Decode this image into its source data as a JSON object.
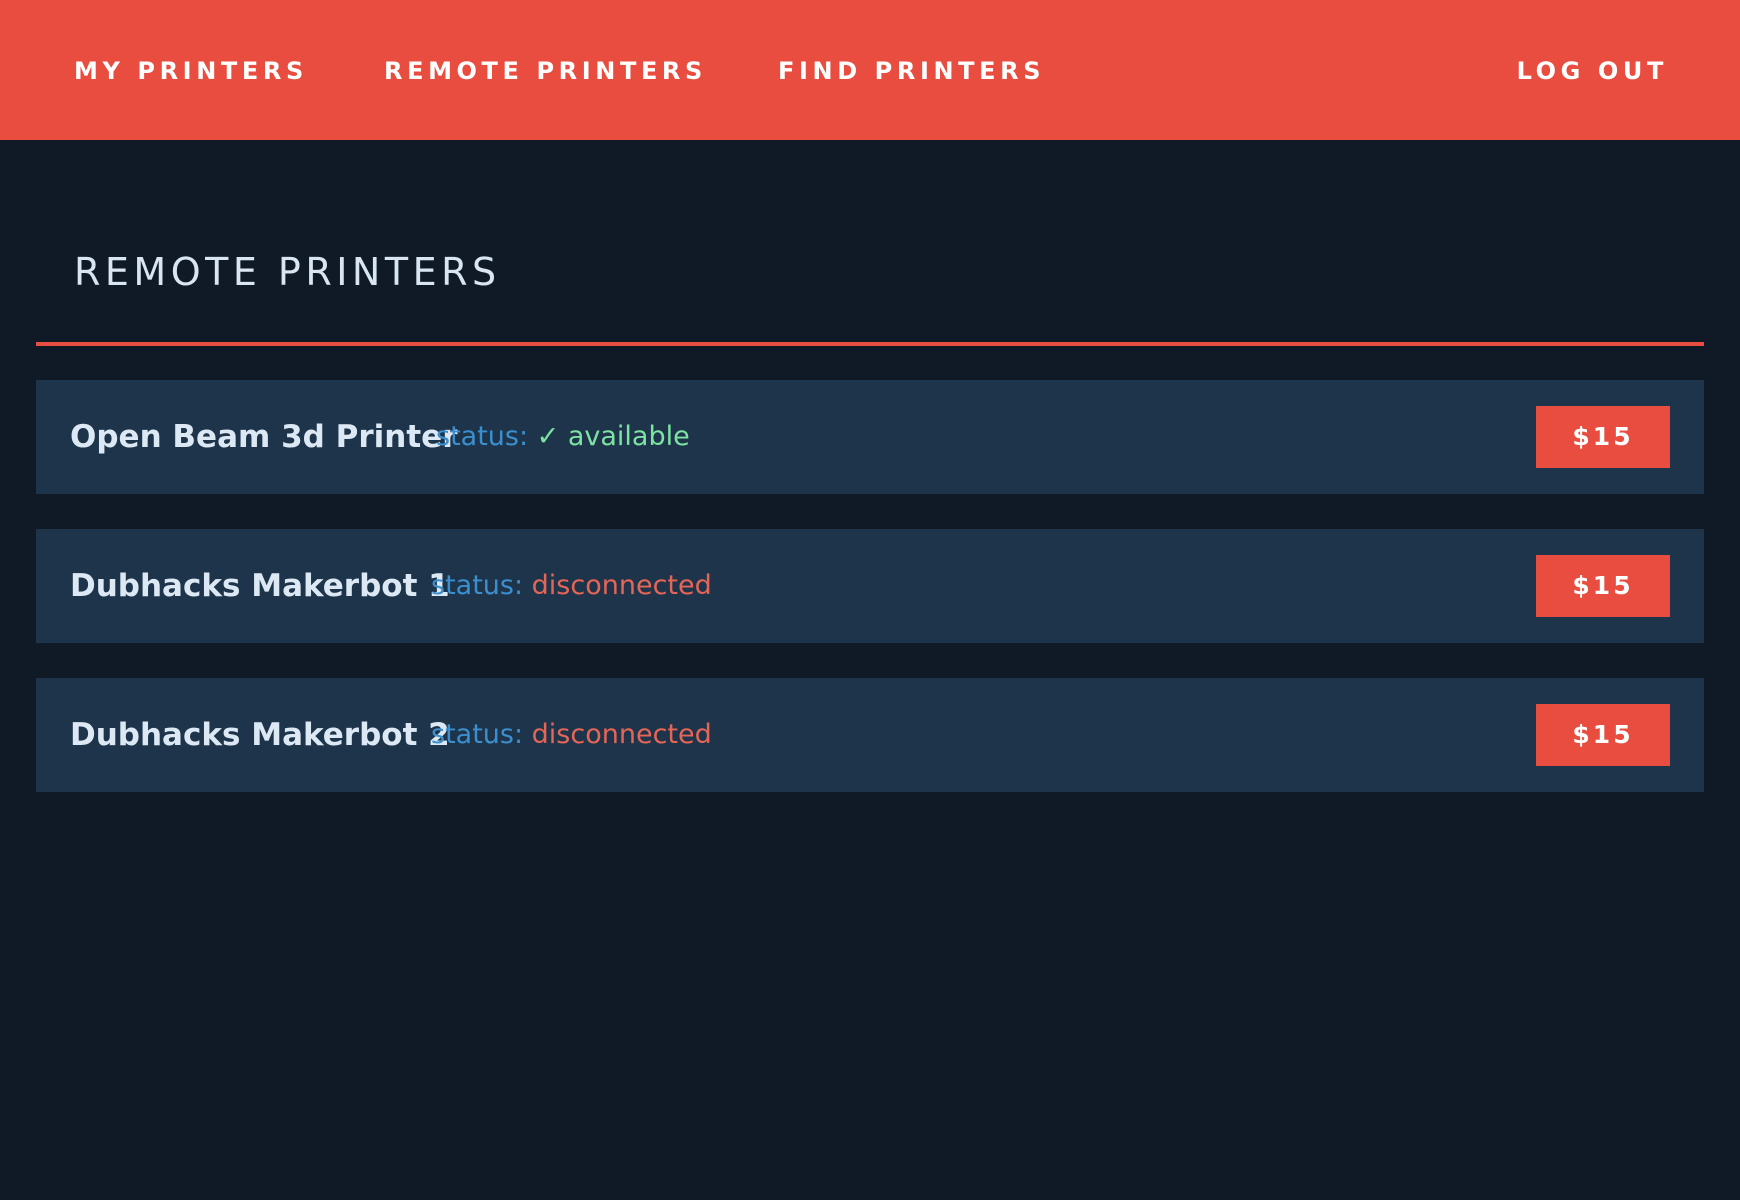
{
  "nav": {
    "my_printers": "MY PRINTERS",
    "remote_printers": "REMOTE PRINTERS",
    "find_printers": "FIND PRINTERS",
    "log_out": "LOG OUT"
  },
  "page": {
    "title": "REMOTE PRINTERS"
  },
  "printers": [
    {
      "name": "Open Beam 3d Printer",
      "status_label": "status:",
      "status_value": "✓ available",
      "price": "$15"
    },
    {
      "name": "Dubhacks Makerbot 1",
      "status_label": "status:",
      "status_value": "disconnected",
      "price": "$15"
    },
    {
      "name": "Dubhacks Makerbot 2",
      "status_label": "status:",
      "status_value": "disconnected",
      "price": "$15"
    }
  ],
  "colors": {
    "accent": "#e84d3f",
    "background": "#0f1a26",
    "row_background": "#1e344a",
    "status_label": "#3b8fcf",
    "status_available": "#7de3a3",
    "status_disconnected": "#e56556"
  }
}
